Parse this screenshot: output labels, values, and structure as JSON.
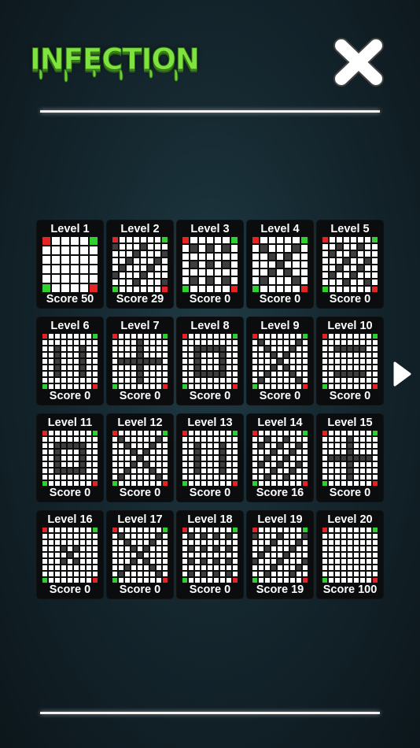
{
  "header": {
    "logo_text": "INFECTION"
  },
  "icons": {
    "close": "close-x-icon",
    "next": "play-arrow-icon"
  },
  "colors": {
    "logo": "#7ee23f",
    "red_piece": "#e52525",
    "green_piece": "#2ed12e",
    "wall": "#3e3e3e",
    "empty": "#ffffff"
  },
  "levels": [
    {
      "label": "Level 1",
      "score": "Score 50",
      "size": 6,
      "pattern": "none"
    },
    {
      "label": "Level 2",
      "score": "Score 29",
      "size": 8,
      "pattern": "diag"
    },
    {
      "label": "Level 3",
      "score": "Score 0",
      "size": 7,
      "pattern": "grid"
    },
    {
      "label": "Level 4",
      "score": "Score 0",
      "size": 7,
      "pattern": "x"
    },
    {
      "label": "Level 5",
      "score": "Score 0",
      "size": 8,
      "pattern": "check"
    },
    {
      "label": "Level 6",
      "score": "Score 0",
      "size": 9,
      "pattern": "cols"
    },
    {
      "label": "Level 7",
      "score": "Score 0",
      "size": 9,
      "pattern": "plus"
    },
    {
      "label": "Level 8",
      "score": "Score 0",
      "size": 9,
      "pattern": "ring"
    },
    {
      "label": "Level 9",
      "score": "Score 0",
      "size": 9,
      "pattern": "x"
    },
    {
      "label": "Level 10",
      "score": "Score 0",
      "size": 9,
      "pattern": "rows"
    },
    {
      "label": "Level 11",
      "score": "Score 0",
      "size": 9,
      "pattern": "ring"
    },
    {
      "label": "Level 12",
      "score": "Score 0",
      "size": 9,
      "pattern": "x"
    },
    {
      "label": "Level 13",
      "score": "Score 0",
      "size": 9,
      "pattern": "cols"
    },
    {
      "label": "Level 14",
      "score": "Score 16",
      "size": 9,
      "pattern": "check"
    },
    {
      "label": "Level 15",
      "score": "Score 0",
      "size": 9,
      "pattern": "plus"
    },
    {
      "label": "Level 16",
      "score": "Score 0",
      "size": 9,
      "pattern": "center"
    },
    {
      "label": "Level 17",
      "score": "Score 0",
      "size": 9,
      "pattern": "x"
    },
    {
      "label": "Level 18",
      "score": "Score 0",
      "size": 9,
      "pattern": "grid"
    },
    {
      "label": "Level 19",
      "score": "Score 19",
      "size": 9,
      "pattern": "diag"
    },
    {
      "label": "Level 20",
      "score": "Score 100",
      "size": 9,
      "pattern": "none"
    }
  ]
}
